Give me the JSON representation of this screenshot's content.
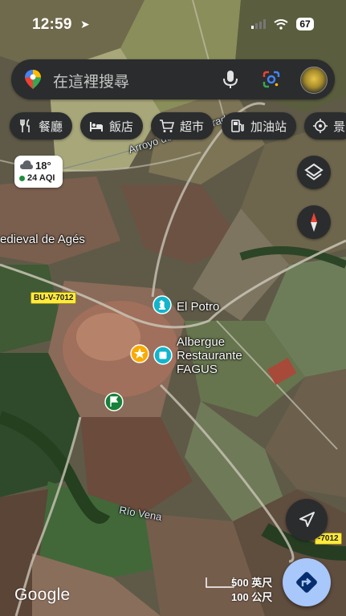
{
  "status": {
    "time": "12:59",
    "battery": "67"
  },
  "search": {
    "placeholder": "在這裡搜尋"
  },
  "chips": [
    {
      "label": "餐廳",
      "icon": "restaurant-icon"
    },
    {
      "label": "飯店",
      "icon": "hotel-icon"
    },
    {
      "label": "超市",
      "icon": "cart-icon"
    },
    {
      "label": "加油站",
      "icon": "gas-station-icon"
    },
    {
      "label": "景",
      "icon": "attraction-icon"
    }
  ],
  "weather": {
    "temp": "18°",
    "aqi": "24 AQI"
  },
  "map_labels": {
    "stream1": "Arroyo de Campogrado",
    "place": "edieval de Agés",
    "poi1": "El Potro",
    "poi2": "Albergue\nRestaurante\nFAGUS",
    "river": "Río Vena",
    "road1": "BU-V-7012",
    "road2": "-7012"
  },
  "scale": {
    "ft": "500 英尺",
    "m": "100 公尺"
  },
  "brand": "Google",
  "colors": {
    "chip_bg": "#2b2c2e",
    "directions": "#a8c7fa",
    "poi_teal": "#12b5cb"
  }
}
